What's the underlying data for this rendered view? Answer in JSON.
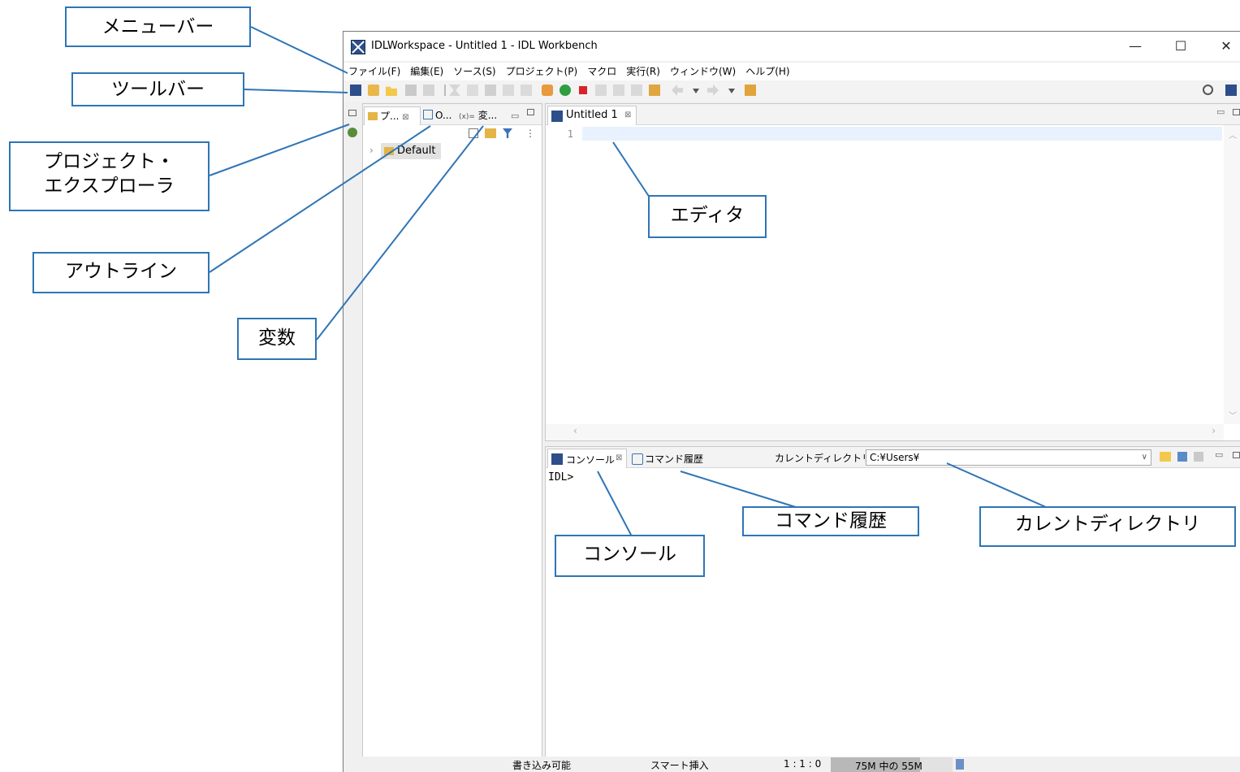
{
  "window": {
    "title": "IDLWorkspace - Untitled 1 - IDL Workbench",
    "minimize": "—",
    "maximize": "☐",
    "close": "✕"
  },
  "menu": [
    "ファイル(F)",
    "編集(E)",
    "ソース(S)",
    "プロジェクト(P)",
    "マクロ",
    "実行(R)",
    "ウィンドウ(W)",
    "ヘルプ(H)"
  ],
  "left_tabs": {
    "project": "プ...",
    "outline": "O...",
    "variables": "変..."
  },
  "tree": {
    "default_project": "Default"
  },
  "editor": {
    "tab_label": "Untitled 1",
    "line_number": "1"
  },
  "console": {
    "tab_label": "コンソール",
    "history_tab_label": "コマンド履歴",
    "cwd_label": "カレントディレクトリ:",
    "cwd_value": "C:¥Users¥",
    "prompt": "IDL>"
  },
  "status": {
    "writable": "書き込み可能",
    "insert_mode": "スマート挿入",
    "position": "1 : 1 : 0",
    "heap": "75M 中の 55M",
    "heap_used_fraction": 0.73
  },
  "annotations": {
    "menubar": "メニューバー",
    "toolbar": "ツールバー",
    "project_explorer_line1": "プロジェクト・",
    "project_explorer_line2": "エクスプローラ",
    "outline": "アウトライン",
    "variables": "変数",
    "editor": "エディタ",
    "command_history": "コマンド履歴",
    "current_directory": "カレントディレクトリ",
    "console": "コンソール"
  },
  "colors": {
    "callout_border": "#2e75b6",
    "run_green": "#2e9e3e",
    "stop_red": "#d9232b",
    "idl_blue": "#2d4e8a"
  }
}
